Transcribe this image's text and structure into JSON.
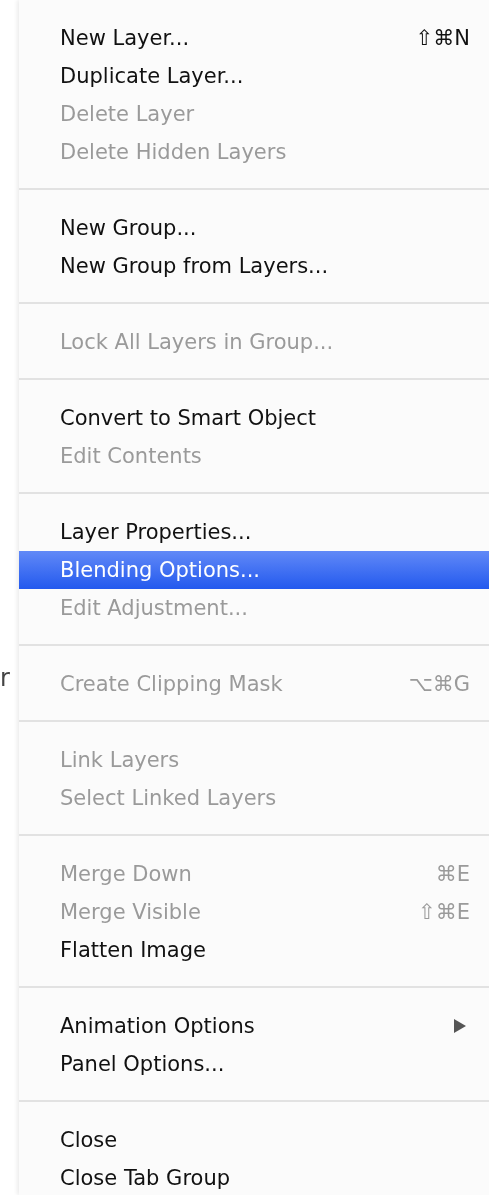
{
  "background_text": "r",
  "menu": {
    "sections": [
      {
        "items": [
          {
            "label": "New Layer...",
            "shortcut": "⇧⌘N",
            "disabled": false,
            "selected": false,
            "submenu": false
          },
          {
            "label": "Duplicate Layer...",
            "disabled": false,
            "selected": false,
            "submenu": false
          },
          {
            "label": "Delete Layer",
            "disabled": true,
            "selected": false,
            "submenu": false
          },
          {
            "label": "Delete Hidden Layers",
            "disabled": true,
            "selected": false,
            "submenu": false
          }
        ]
      },
      {
        "items": [
          {
            "label": "New Group...",
            "disabled": false,
            "selected": false,
            "submenu": false
          },
          {
            "label": "New Group from Layers...",
            "disabled": false,
            "selected": false,
            "submenu": false
          }
        ]
      },
      {
        "items": [
          {
            "label": "Lock All Layers in Group...",
            "disabled": true,
            "selected": false,
            "submenu": false
          }
        ]
      },
      {
        "items": [
          {
            "label": "Convert to Smart Object",
            "disabled": false,
            "selected": false,
            "submenu": false
          },
          {
            "label": "Edit Contents",
            "disabled": true,
            "selected": false,
            "submenu": false
          }
        ]
      },
      {
        "items": [
          {
            "label": "Layer Properties...",
            "disabled": false,
            "selected": false,
            "submenu": false
          },
          {
            "label": "Blending Options...",
            "disabled": false,
            "selected": true,
            "submenu": false
          },
          {
            "label": "Edit Adjustment...",
            "disabled": true,
            "selected": false,
            "submenu": false
          }
        ]
      },
      {
        "items": [
          {
            "label": "Create Clipping Mask",
            "shortcut": "⌥⌘G",
            "disabled": true,
            "selected": false,
            "submenu": false
          }
        ]
      },
      {
        "items": [
          {
            "label": "Link Layers",
            "disabled": true,
            "selected": false,
            "submenu": false
          },
          {
            "label": "Select Linked Layers",
            "disabled": true,
            "selected": false,
            "submenu": false
          }
        ]
      },
      {
        "items": [
          {
            "label": "Merge Down",
            "shortcut": "⌘E",
            "disabled": true,
            "selected": false,
            "submenu": false
          },
          {
            "label": "Merge Visible",
            "shortcut": "⇧⌘E",
            "disabled": true,
            "selected": false,
            "submenu": false
          },
          {
            "label": "Flatten Image",
            "disabled": false,
            "selected": false,
            "submenu": false
          }
        ]
      },
      {
        "items": [
          {
            "label": "Animation Options",
            "disabled": false,
            "selected": false,
            "submenu": true
          },
          {
            "label": "Panel Options...",
            "disabled": false,
            "selected": false,
            "submenu": false
          }
        ]
      },
      {
        "items": [
          {
            "label": "Close",
            "disabled": false,
            "selected": false,
            "submenu": false
          },
          {
            "label": "Close Tab Group",
            "disabled": false,
            "selected": false,
            "submenu": false
          }
        ]
      }
    ]
  }
}
